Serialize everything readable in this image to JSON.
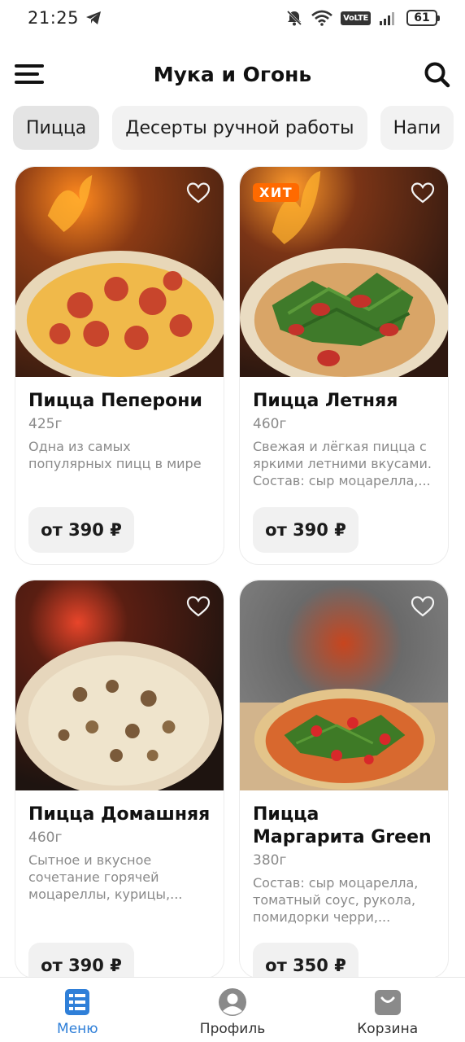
{
  "status_bar": {
    "time": "21:25",
    "network": "VoLTE",
    "battery": "61"
  },
  "header": {
    "title": "Мука и Огонь"
  },
  "tabs": [
    {
      "label": "Пицца",
      "active": true
    },
    {
      "label": "Десерты ручной работы",
      "active": false
    },
    {
      "label": "Напи",
      "active": false
    }
  ],
  "products": [
    {
      "name": "Пицца Пеперони",
      "weight": "425г",
      "description": "Одна из самых популярных пицц в мире",
      "price": "от 390 ₽",
      "badge": ""
    },
    {
      "name": "Пицца Летняя",
      "weight": "460г",
      "description": "Свежая и лёгкая пицца с яркими летними вкусами. Состав: сыр моцарелла,...",
      "price": "от 390 ₽",
      "badge": "ХИТ"
    },
    {
      "name": "Пицца Домашняя",
      "weight": "460г",
      "description": "Сытное и вкусное сочетание горячей моцареллы, курицы,...",
      "price": "от 390 ₽",
      "badge": ""
    },
    {
      "name": "Пицца Маргарита Green",
      "weight": "380г",
      "description": "Состав: сыр моцарелла, томатный соус, рукола, помидорки черри,...",
      "price": "от 350 ₽",
      "badge": ""
    }
  ],
  "bottom_nav": [
    {
      "label": "Меню",
      "icon": "menu-list-icon",
      "active": true
    },
    {
      "label": "Профиль",
      "icon": "profile-icon",
      "active": false
    },
    {
      "label": "Корзина",
      "icon": "cart-bag-icon",
      "active": false
    }
  ],
  "colors": {
    "accent": "#2f7fd8",
    "badge": "#ff6a00",
    "tab_bg": "#f2f2f2",
    "price_bg": "#f1f1f1"
  }
}
